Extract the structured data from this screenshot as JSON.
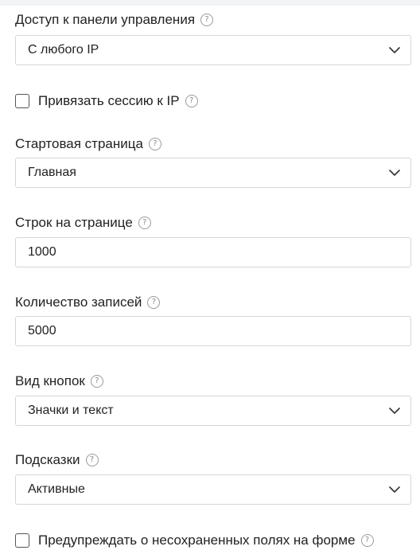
{
  "settings": {
    "panel_access": {
      "label": "Доступ к панели управления",
      "value": "С любого IP"
    },
    "bind_session": {
      "label": "Привязать сессию к IP",
      "checked": false
    },
    "start_page": {
      "label": "Стартовая страница",
      "value": "Главная"
    },
    "rows_per_page": {
      "label": "Строк на странице",
      "value": "1000"
    },
    "record_count": {
      "label": "Количество записей",
      "value": "5000"
    },
    "button_style": {
      "label": "Вид кнопок",
      "value": "Значки и текст"
    },
    "hints": {
      "label": "Подсказки",
      "value": "Активные"
    },
    "warn_unsaved": {
      "label": "Предупреждать о несохраненных полях на форме",
      "checked": false
    }
  },
  "help_glyph": "?"
}
